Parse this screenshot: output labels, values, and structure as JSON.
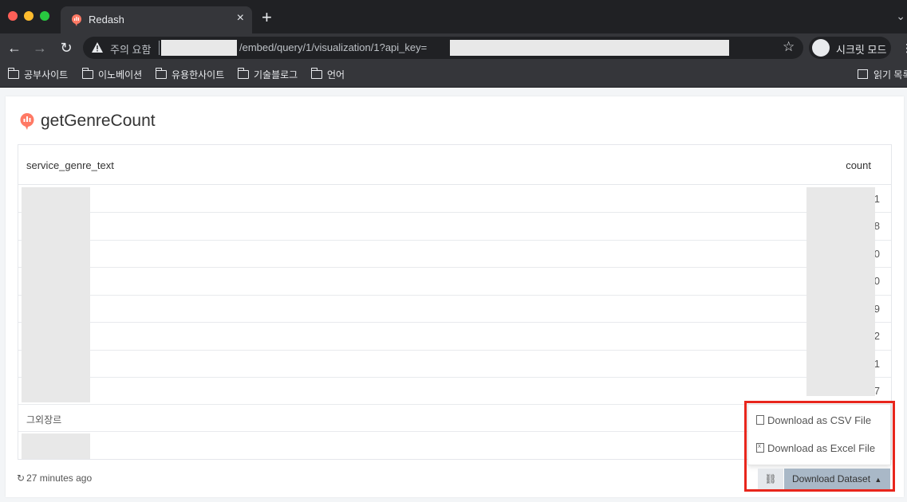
{
  "browser": {
    "tab_title": "Redash",
    "tab_close": "×",
    "new_tab": "+",
    "security_label": "주의 요함",
    "url_path": "/embed/query/1/visualization/1?api_key=",
    "incognito_label": "시크릿 모드",
    "bookmarks": [
      "공부사이트",
      "이노베이션",
      "유용한사이트",
      "기술블로그",
      "언어"
    ],
    "reading_list": "읽기 목록"
  },
  "query": {
    "title": "getGenreCount"
  },
  "table": {
    "columns": [
      "service_genre_text",
      "count"
    ],
    "rows": [
      {
        "genre": "",
        "count": "1"
      },
      {
        "genre": "",
        "count": "8"
      },
      {
        "genre": "",
        "count": "0"
      },
      {
        "genre": "",
        "count": "0"
      },
      {
        "genre": "",
        "count": "9"
      },
      {
        "genre": "",
        "count": "2"
      },
      {
        "genre": "",
        "count": "1"
      },
      {
        "genre": "",
        "count": "7"
      },
      {
        "genre": "그외장르",
        "count": ""
      },
      {
        "genre": "",
        "count": ""
      }
    ]
  },
  "footer": {
    "updated_text": "27 minutes ago",
    "download_dataset": "Download Dataset",
    "menu": {
      "csv": "Download as CSV File",
      "excel": "Download as Excel File"
    }
  },
  "colors": {
    "highlight": "#e8261c",
    "download_button": "#a9b8c7",
    "redash_logo": "#ff7964"
  }
}
